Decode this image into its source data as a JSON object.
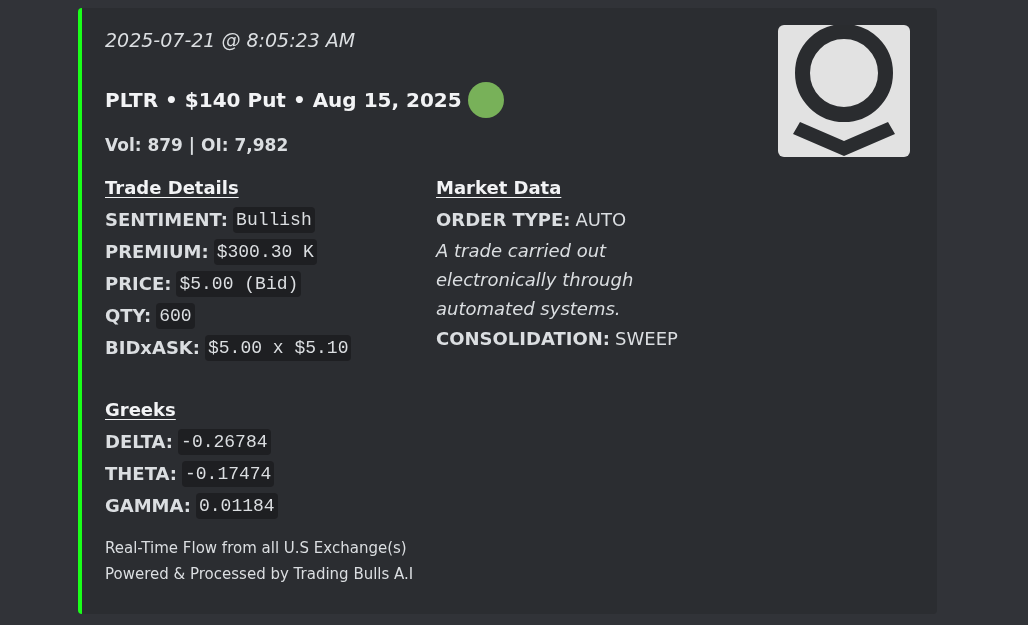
{
  "embed": {
    "timestamp": "2025-07-21 @ 8:05:23 AM",
    "title": "PLTR • $140 Put • Aug 15, 2025",
    "summary": "Vol: 879 | OI: 7,982",
    "field_rows": [
      {
        "sections": [
          {
            "heading": "Trade Details",
            "fields": [
              {
                "kind": "code",
                "label": "SENTIMENT:",
                "value": "Bullish"
              },
              {
                "kind": "code",
                "label": "PREMIUM:",
                "value": "$300.30 K"
              },
              {
                "kind": "code",
                "label": "PRICE:",
                "value": "$5.00 (Bid)"
              },
              {
                "kind": "code",
                "label": "QTY:",
                "value": "600"
              },
              {
                "kind": "code",
                "label": "BIDxASK:",
                "value": "$5.00 x $5.10"
              }
            ]
          },
          {
            "heading": "Market Data",
            "fields": [
              {
                "kind": "plain",
                "label": "ORDER TYPE:",
                "value": "AUTO"
              },
              {
                "kind": "note",
                "text": "A trade carried out electronically through automated systems."
              },
              {
                "kind": "plain",
                "label": "CONSOLIDATION:",
                "value": "SWEEP"
              }
            ]
          }
        ]
      },
      {
        "sections": [
          {
            "heading": "Greeks",
            "fields": [
              {
                "kind": "code",
                "label": "DELTA:",
                "value": "-0.26784"
              },
              {
                "kind": "code",
                "label": "THETA:",
                "value": "-0.17474"
              },
              {
                "kind": "code",
                "label": "GAMMA:",
                "value": "0.01184"
              }
            ]
          }
        ]
      }
    ],
    "footer": [
      "Real-Time Flow from all U.S Exchange(s)",
      "Powered & Processed by Trading Bulls A.I"
    ]
  }
}
